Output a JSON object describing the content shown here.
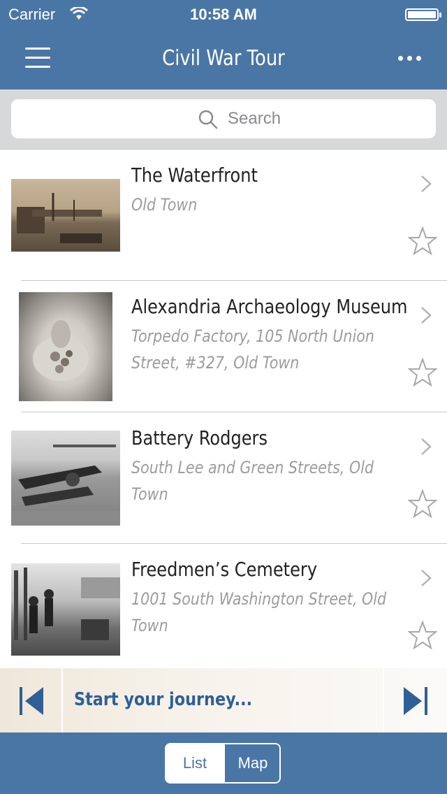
{
  "status_bar": {
    "carrier": "Carrier",
    "time": "10:58 AM"
  },
  "nav": {
    "title": "Civil War Tour",
    "menu_icon": "hamburger-menu-icon",
    "more_icon": "ellipsis-icon"
  },
  "search": {
    "placeholder": "Search"
  },
  "places": [
    {
      "title": "The Waterfront",
      "subtitle": "Old Town"
    },
    {
      "title": "Alexandria Archaeology Museum",
      "subtitle": "Torpedo Factory, 105 North Union Street, #327, Old Town"
    },
    {
      "title": "Battery Rodgers",
      "subtitle": "South Lee and Green Streets, Old Town"
    },
    {
      "title": "Freedmen’s  Cemetery",
      "subtitle": "1001 South Washington Street, Old Town"
    }
  ],
  "player": {
    "text": "Start your journey..."
  },
  "view_toggle": {
    "list_label": "List",
    "map_label": "Map",
    "selected": "List"
  },
  "colors": {
    "brand_blue": "#4a76a6",
    "player_text": "#2f5f95"
  }
}
